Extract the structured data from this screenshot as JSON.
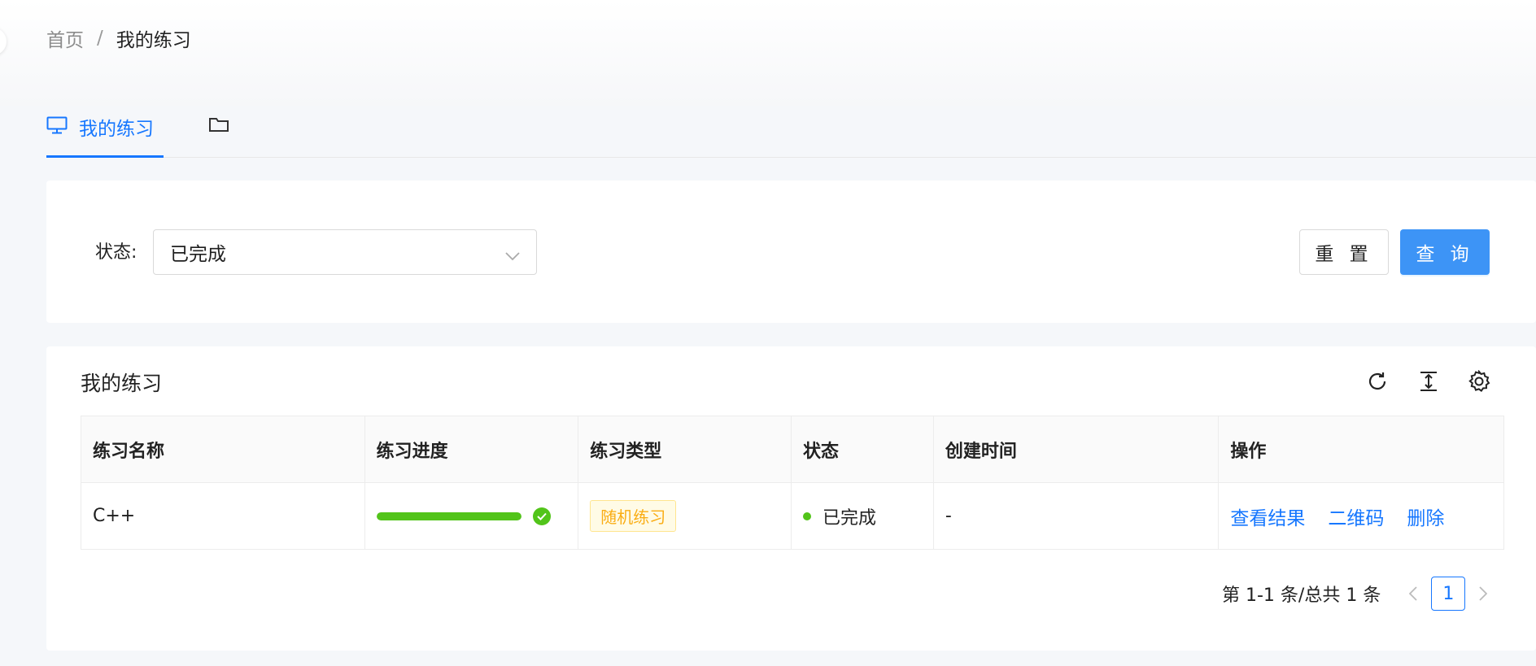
{
  "breadcrumb": {
    "home": "首页",
    "separator": "/",
    "current": "我的练习"
  },
  "tabs": {
    "active_label": "我的练习"
  },
  "filter": {
    "label": "状态:",
    "status_value": "已完成"
  },
  "buttons": {
    "reset": "重 置",
    "query": "查 询"
  },
  "table": {
    "title": "我的练习",
    "columns": [
      "练习名称",
      "练习进度",
      "练习类型",
      "状态",
      "创建时间",
      "操作"
    ],
    "rows": [
      {
        "name": "C++",
        "progress": 1.0,
        "type": "随机练习",
        "status": "已完成",
        "created": "-",
        "actions": [
          "查看结果",
          "二维码",
          "删除"
        ]
      }
    ]
  },
  "pagination": {
    "summary": "第 1-1 条/总共 1 条",
    "current_page": "1"
  },
  "colors": {
    "primary": "#1677ff",
    "success": "#52c41a",
    "warning": "#faad14"
  },
  "icons": [
    "desktop-icon",
    "folder-icon",
    "chevron-down-icon",
    "reload-icon",
    "column-height-icon",
    "setting-icon",
    "check-circle-icon",
    "left-icon",
    "right-icon"
  ]
}
